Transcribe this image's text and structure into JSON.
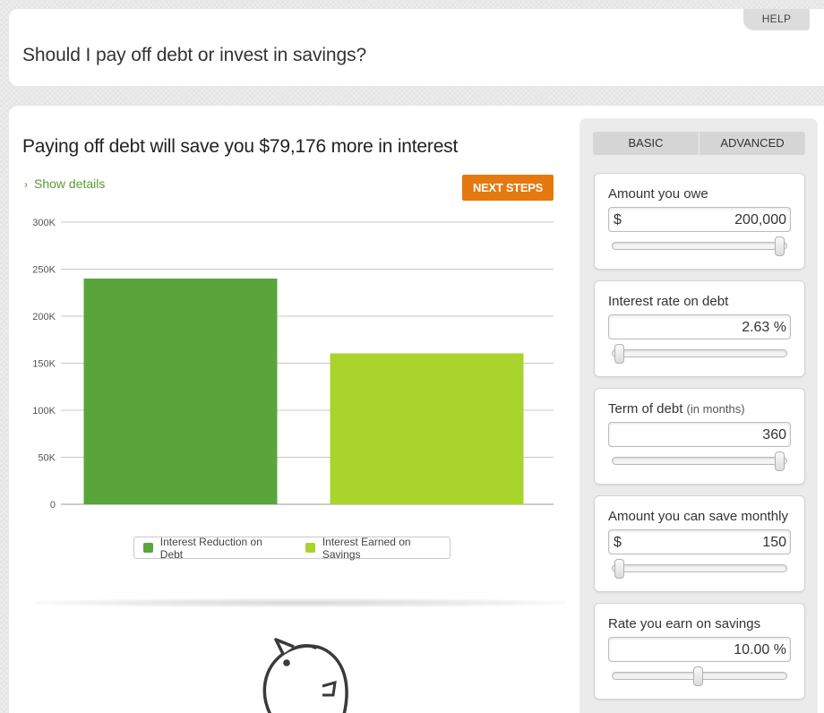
{
  "header": {
    "help_label": "HELP",
    "title": "Should I pay off debt or invest in savings?"
  },
  "result": {
    "heading": "Paying off debt will save you $79,176 more in interest",
    "show_details": "Show details",
    "next_steps": "NEXT STEPS"
  },
  "chart_data": {
    "type": "bar",
    "categories": [
      "Interest Reduction on Debt",
      "Interest Earned on Savings"
    ],
    "values": [
      240000,
      160500
    ],
    "colors": [
      "#5aa43c",
      "#a8d42b"
    ],
    "ylim": [
      0,
      300000
    ],
    "yticks": [
      0,
      50000,
      100000,
      150000,
      200000,
      250000,
      300000
    ],
    "ytick_labels": [
      "0",
      "50K",
      "100K",
      "150K",
      "200K",
      "250K",
      "300K"
    ],
    "grid": true,
    "legend": [
      "Interest Reduction on Debt",
      "Interest Earned on Savings"
    ],
    "legend_position": "bottom"
  },
  "panel": {
    "tabs": [
      {
        "label": "BASIC"
      },
      {
        "label": "ADVANCED"
      }
    ],
    "fields": [
      {
        "label": "Amount you owe",
        "sublabel": "",
        "prefix": "$",
        "value": "200,000",
        "slider": 1.0
      },
      {
        "label": "Interest rate on debt",
        "sublabel": "",
        "prefix": "",
        "value": "2.63 %",
        "slider": 0.02
      },
      {
        "label": "Term of debt",
        "sublabel": "(in months)",
        "prefix": "",
        "value": "360",
        "slider": 1.0
      },
      {
        "label": "Amount you can save monthly",
        "sublabel": "",
        "prefix": "$",
        "value": "150",
        "slider": 0.02
      },
      {
        "label": "Rate you earn on savings",
        "sublabel": "",
        "prefix": "",
        "value": "10.00 %",
        "slider": 0.5
      }
    ]
  },
  "icons": {
    "piggy": "piggy-bank-icon",
    "chevron": "chevron-right-icon"
  }
}
